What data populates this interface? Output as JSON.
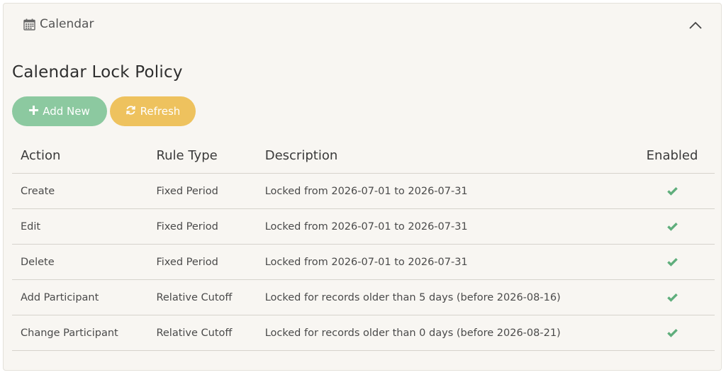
{
  "panel": {
    "title": "Calendar",
    "title_icon": "calendar-icon",
    "collapse_icon": "chevron-up-icon"
  },
  "policy": {
    "title": "Calendar Lock Policy"
  },
  "toolbar": {
    "add_label": "Add New",
    "add_icon": "plus-icon",
    "refresh_label": "Refresh",
    "refresh_icon": "refresh-icon"
  },
  "table": {
    "headers": {
      "action": "Action",
      "rule_type": "Rule Type",
      "description": "Description",
      "enabled": "Enabled"
    },
    "rows": [
      {
        "action": "Create",
        "rule_type": "Fixed Period",
        "description": "Locked from 2026-07-01 to 2026-07-31",
        "enabled": true
      },
      {
        "action": "Edit",
        "rule_type": "Fixed Period",
        "description": "Locked from 2026-07-01 to 2026-07-31",
        "enabled": true
      },
      {
        "action": "Delete",
        "rule_type": "Fixed Period",
        "description": "Locked from 2026-07-01 to 2026-07-31",
        "enabled": true
      },
      {
        "action": "Add Participant",
        "rule_type": "Relative Cutoff",
        "description": "Locked for records older than 5 days (before 2026-08-16)",
        "enabled": true
      },
      {
        "action": "Change Participant",
        "rule_type": "Relative Cutoff",
        "description": "Locked for records older than 0 days (before 2026-08-21)",
        "enabled": true
      }
    ]
  },
  "colors": {
    "add_button": "#8cc9a0",
    "refresh_button": "#eec25e",
    "check": "#5fae7c",
    "panel_bg": "#f8f6f2"
  }
}
